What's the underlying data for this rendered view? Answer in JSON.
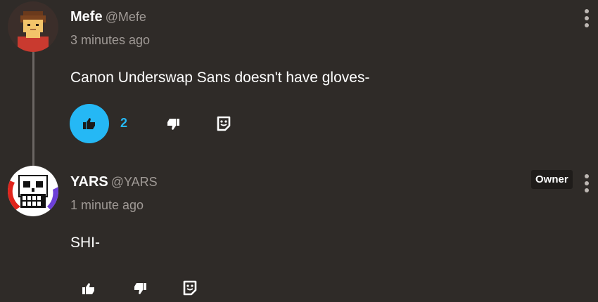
{
  "comments": [
    {
      "author": "Mefe",
      "handle": "@Mefe",
      "time": "3 minutes ago",
      "body": "Canon Underswap Sans doesn't have gloves-",
      "likes": "2",
      "liked": true,
      "avatar_icon": "pixel-character-avatar",
      "badge": ""
    },
    {
      "author": "YARS",
      "handle": "@YARS",
      "time": "1 minute ago",
      "body": "SHI-",
      "likes": "",
      "liked": false,
      "avatar_icon": "skull-avatar",
      "badge": "Owner"
    }
  ],
  "colors": {
    "background": "#2f2b28",
    "accent": "#25b8f5",
    "muted_text": "#a09a96"
  },
  "icons": [
    "thumbs-up-icon",
    "thumbs-down-icon",
    "sticker-icon",
    "more-vertical-icon"
  ]
}
